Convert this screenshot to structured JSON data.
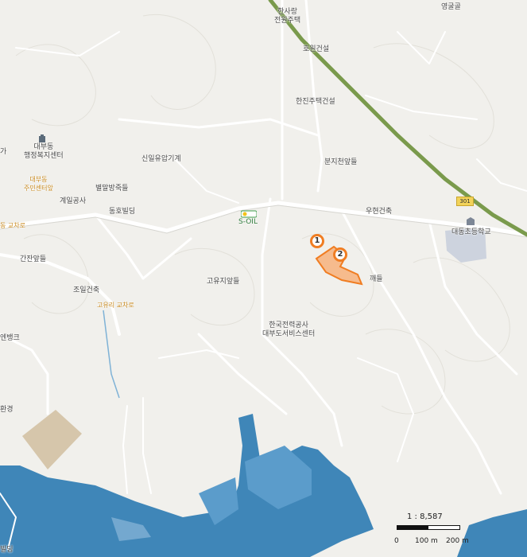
{
  "labels": {
    "hansarang": "한사랑\n전원주택",
    "younggulgol": "영굴골",
    "howon": "호원건설",
    "hanjin": "한진주택건설",
    "daebudong_welfare": "대부동\n행정복지센터",
    "daebudong_center": "대부동\n주민센터앞",
    "sinil": "신일유압기계",
    "bunji": "분지천앞들",
    "byeolmal": "별말방죽들",
    "gyeil": "계일공사",
    "donghoVilla": "동호빌딩",
    "woohyun": "우현건축",
    "soil": "S-OIL",
    "daedong_school": "대동초등학교",
    "gyodong_intersection": "동 교차로",
    "ganjeon": "간잔앞들",
    "goyuji": "고유지앞들",
    "kkaedeul": "깨들",
    "joil": "조일건축",
    "gouri_intersection": "고유리 교차로",
    "kepco": "한국전력공사\n대부도서비스센터",
    "bank": "엔뱅크",
    "hwankyung": "환경",
    "building_bottom": "빌딩",
    "ga": "가"
  },
  "route_sign": "301",
  "pins": [
    "1",
    "2"
  ],
  "scale": {
    "ratio": "1 : 8,587",
    "tick0": "0",
    "tick1": "100 m",
    "tick2": "200 m"
  },
  "colors": {
    "land": "#f1f0ec",
    "water": "#3f86b8",
    "highway": "#7a9a4c",
    "road": "#ffffff",
    "parcel": "#f7a96d",
    "pin": "#f07d22"
  }
}
